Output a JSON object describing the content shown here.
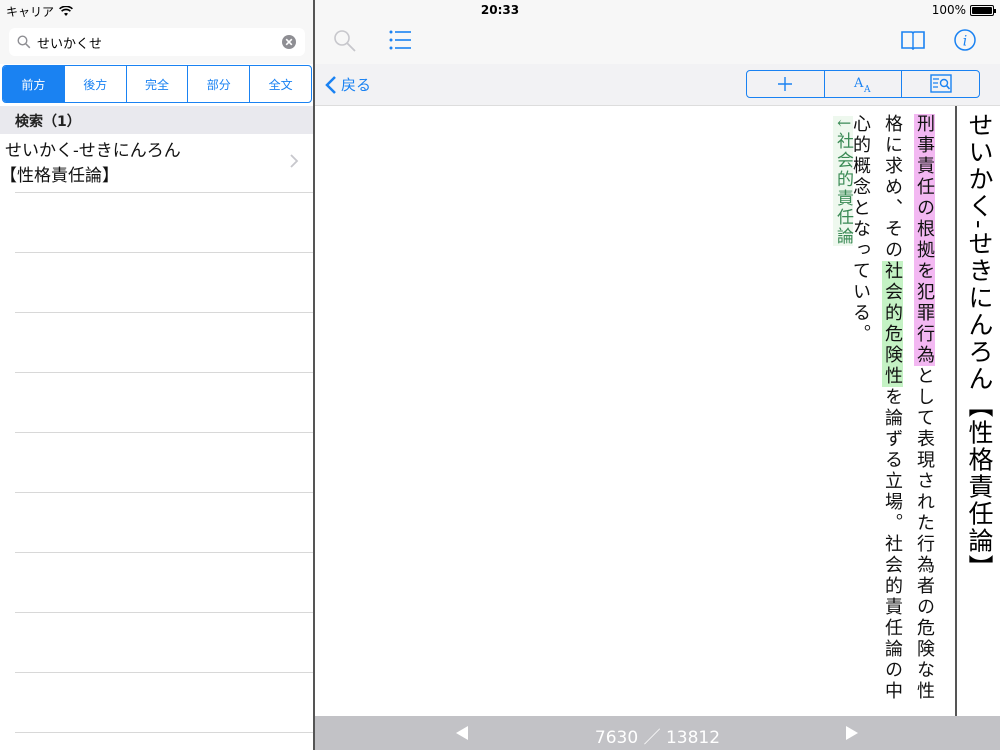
{
  "status": {
    "carrier": "キャリア",
    "time": "20:33",
    "battery_text": "100%",
    "battery_level": 1.0
  },
  "search": {
    "value": "せいかくせ",
    "placeholder": ""
  },
  "segments": [
    {
      "label": "前方",
      "active": true
    },
    {
      "label": "後方",
      "active": false
    },
    {
      "label": "完全",
      "active": false
    },
    {
      "label": "部分",
      "active": false
    },
    {
      "label": "全文",
      "active": false
    }
  ],
  "results": {
    "header": "検索（1）",
    "items": [
      {
        "line1": "せいかく-せきにんろん",
        "line2": "【性格責任論】"
      }
    ]
  },
  "toolbar": {
    "back_label": "戻る",
    "plus_label": "＋",
    "font_label": "AA"
  },
  "entry": {
    "headword": "せいかく-せきにんろん【性格責任論】",
    "body_pink": "刑事責任の根拠を犯罪行為",
    "body_1": "として表現された行為者の危険な性格に求め、その",
    "body_green": "社会的危険性",
    "body_2": "を論ずる立場。社会的責任論の中心的概念となっている。",
    "ref": "↓社会的責任論"
  },
  "pager": {
    "current": "7630",
    "separator": "／",
    "total": "13812"
  }
}
